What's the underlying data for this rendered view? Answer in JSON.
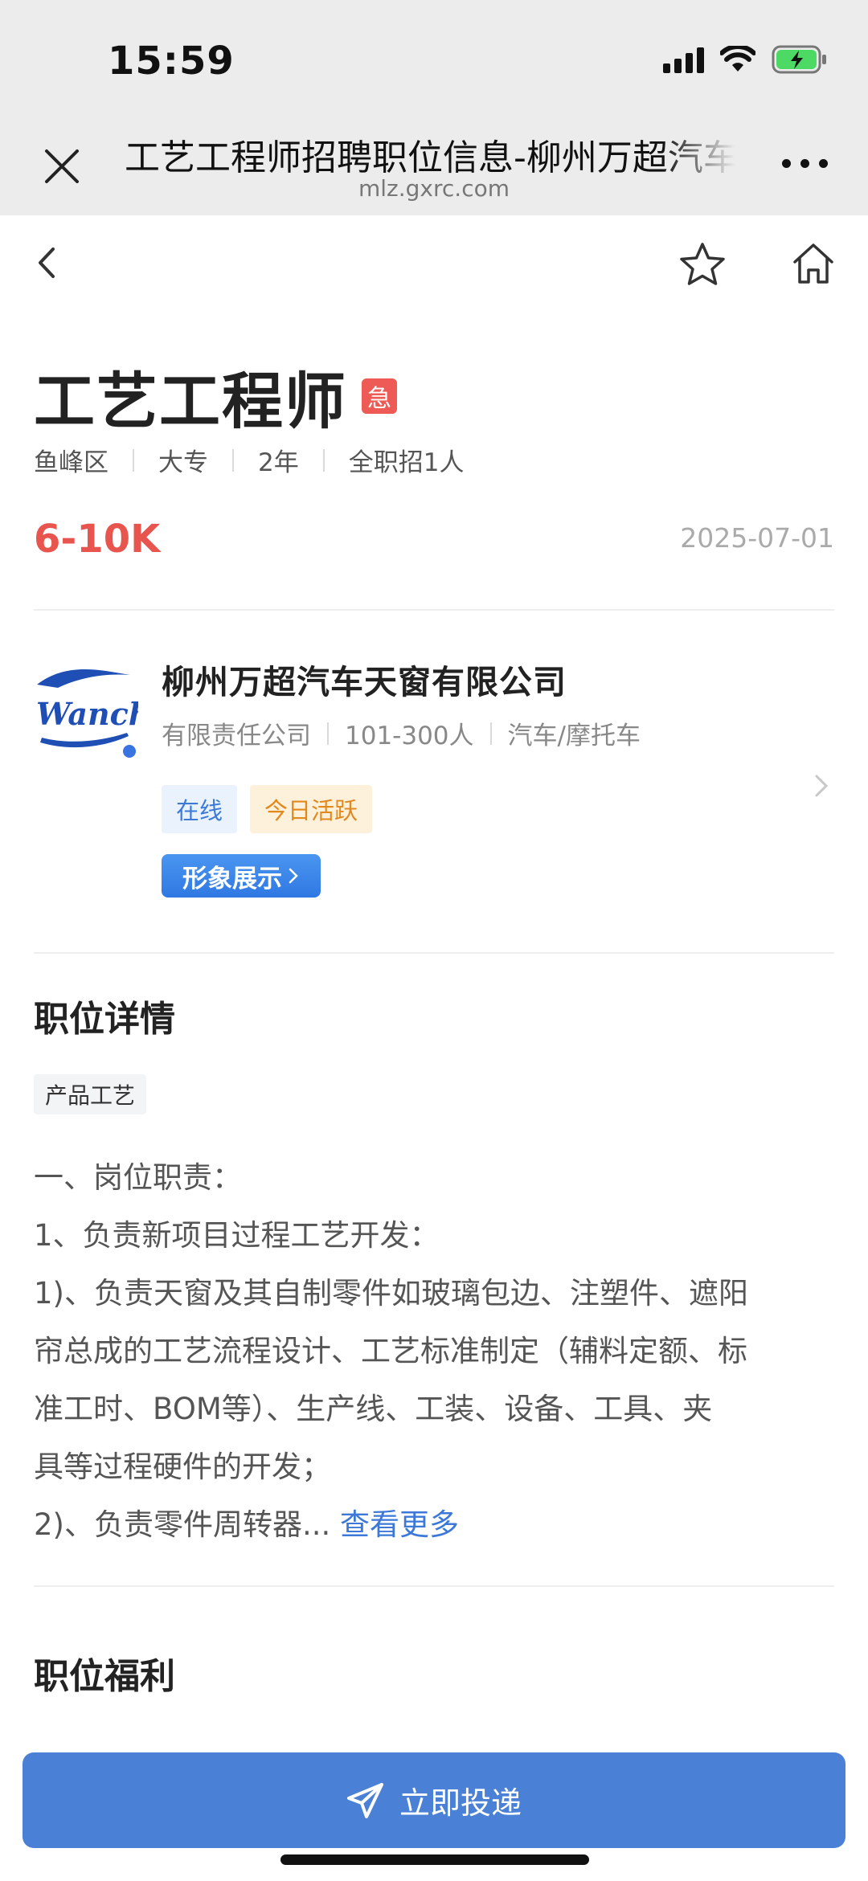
{
  "status_bar": {
    "time": "15:59"
  },
  "browser": {
    "title": "工艺工程师招聘职位信息-柳州万超汽车天窗有限公司",
    "url": "mlz.gxrc.com"
  },
  "job": {
    "title": "工艺工程师",
    "urgent_badge": "急",
    "meta": [
      "鱼峰区",
      "大专",
      "2年",
      "全职招1人"
    ],
    "salary": "6-10K",
    "date": "2025-07-01"
  },
  "company": {
    "logo_text": "Wanchao",
    "name": "柳州万超汽车天窗有限公司",
    "meta": [
      "有限责任公司",
      "101-300人",
      "汽车/摩托车"
    ],
    "tags": [
      "在线",
      "今日活跃"
    ],
    "showcase_label": "形象展示"
  },
  "details": {
    "title": "职位详情",
    "skill_tag": "产品工艺",
    "lines": [
      "一、岗位职责：",
      "1、负责新项目过程工艺开发：",
      "1)、负责天窗及其自制零件如玻璃包边、注塑件、遮阳",
      "帘总成的工艺流程设计、工艺标准制定（辅料定额、标",
      "准工时、BOM等）、生产线、工装、设备、工具、夹",
      "具等过程硬件的开发；"
    ],
    "last_line": "2)、负责零件周转器...",
    "more_label": "查看更多"
  },
  "benefits": {
    "title": "职位福利"
  },
  "apply_button": {
    "label": "立即投递"
  },
  "colors": {
    "salary": "#e8554e",
    "accent_blue": "#4a80d6",
    "urgent": "#ee5a55"
  }
}
